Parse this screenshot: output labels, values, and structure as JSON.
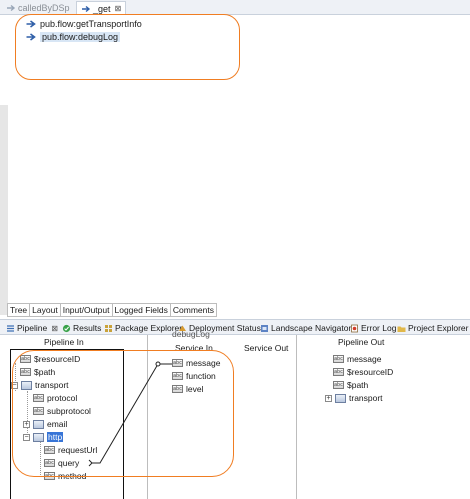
{
  "editor_tabs": [
    {
      "label": "calledByDSp",
      "active": false
    },
    {
      "label": "_get",
      "active": true
    }
  ],
  "tab_close_glyph": "⊠",
  "flow_steps": [
    {
      "label": "pub.flow:getTransportInfo",
      "selected": false
    },
    {
      "label": "pub.flow:debugLog",
      "selected": true
    }
  ],
  "view_tabs": [
    "Tree",
    "Layout",
    "Input/Output",
    "Logged Fields",
    "Comments"
  ],
  "panel_tabs": [
    {
      "label": "Pipeline",
      "icon": "pipeline-icon",
      "active": true
    },
    {
      "label": "Results",
      "icon": "results-icon"
    },
    {
      "label": "Package Explorer",
      "icon": "package-explorer-icon"
    },
    {
      "label": "Deployment Status",
      "icon": "deployment-icon"
    },
    {
      "label": "Landscape Navigator",
      "icon": "landscape-icon"
    },
    {
      "label": "Error Log",
      "icon": "error-log-icon"
    },
    {
      "label": "Project Explorer",
      "icon": "project-explorer-icon"
    }
  ],
  "pipeline": {
    "headers": {
      "pipeline_in": "Pipeline In",
      "service_in": "Service In",
      "service_out": "Service Out",
      "pipeline_out": "Pipeline Out",
      "service_name_fragment": "debugLog"
    },
    "pipeline_in": [
      {
        "label": "$resourceID",
        "type": "field"
      },
      {
        "label": "$path",
        "type": "field"
      },
      {
        "label": "transport",
        "type": "document",
        "expander": "−"
      },
      {
        "label": "protocol",
        "type": "field"
      },
      {
        "label": "subprotocol",
        "type": "field"
      },
      {
        "label": "email",
        "type": "document",
        "expander": "+"
      },
      {
        "label": "http",
        "type": "document",
        "expander": "−",
        "selected": true
      },
      {
        "label": "requestUrl",
        "type": "field"
      },
      {
        "label": "query",
        "type": "field"
      },
      {
        "label": "method",
        "type": "field"
      }
    ],
    "service_in": [
      "message",
      "function",
      "level"
    ],
    "pipeline_out": [
      {
        "label": "message",
        "type": "field"
      },
      {
        "label": "$resourceID",
        "type": "field"
      },
      {
        "label": "$path",
        "type": "field"
      },
      {
        "label": "transport",
        "type": "document",
        "expander": "+"
      }
    ]
  },
  "colors": {
    "highlight_ring": "#f07d22",
    "selection": "#3875d7",
    "tab_bar": "#eef1f6"
  }
}
